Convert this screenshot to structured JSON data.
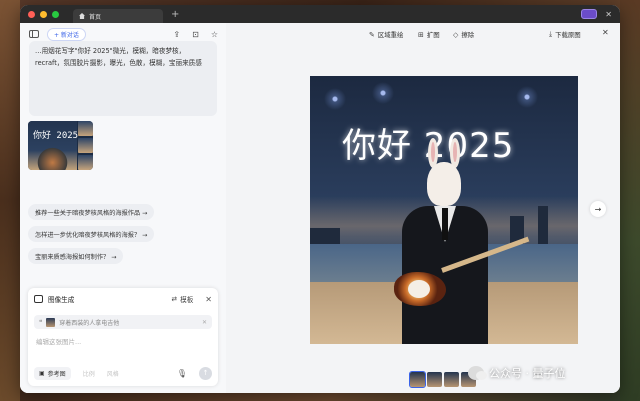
{
  "window": {
    "tab_title": "首页",
    "new_tab_glyph": "+",
    "close_glyph": "✕"
  },
  "left_panel": {
    "new_chat_label": "+ 新对话",
    "chat_message": "…用烟花写字\"你好 2025\"微光，模糊，暗夜梦核，recraft，氛围胶片摄影，曝光，色散，模糊，宝丽来质感",
    "thumb_text": "你好 2025",
    "suggestions": [
      "推荐一些关于暗夜梦核风格的海报作品 →",
      "怎样进一步优化暗夜梦核风格的海报？ →",
      "宝丽来质感海报如何制作？ →"
    ]
  },
  "image_panel": {
    "title": "图像生成",
    "template_label": "模板",
    "ref_chip_text": "穿着西装的人拿电吉他",
    "input_placeholder": "编辑这张图片...",
    "ref_button": "参考图",
    "ratio_button": "比例",
    "style_button": "风格"
  },
  "viewer": {
    "tools": {
      "area_redraw": "区域重绘",
      "expand": "扩图",
      "erase": "擦除",
      "download": "下载原图"
    },
    "image_text": "你好 2025",
    "thumbnail_count": 4
  },
  "watermark": {
    "text": "公众号 · 量子位"
  },
  "colors": {
    "accent": "#3a63e8",
    "titlebar": "#2b2b2b"
  }
}
